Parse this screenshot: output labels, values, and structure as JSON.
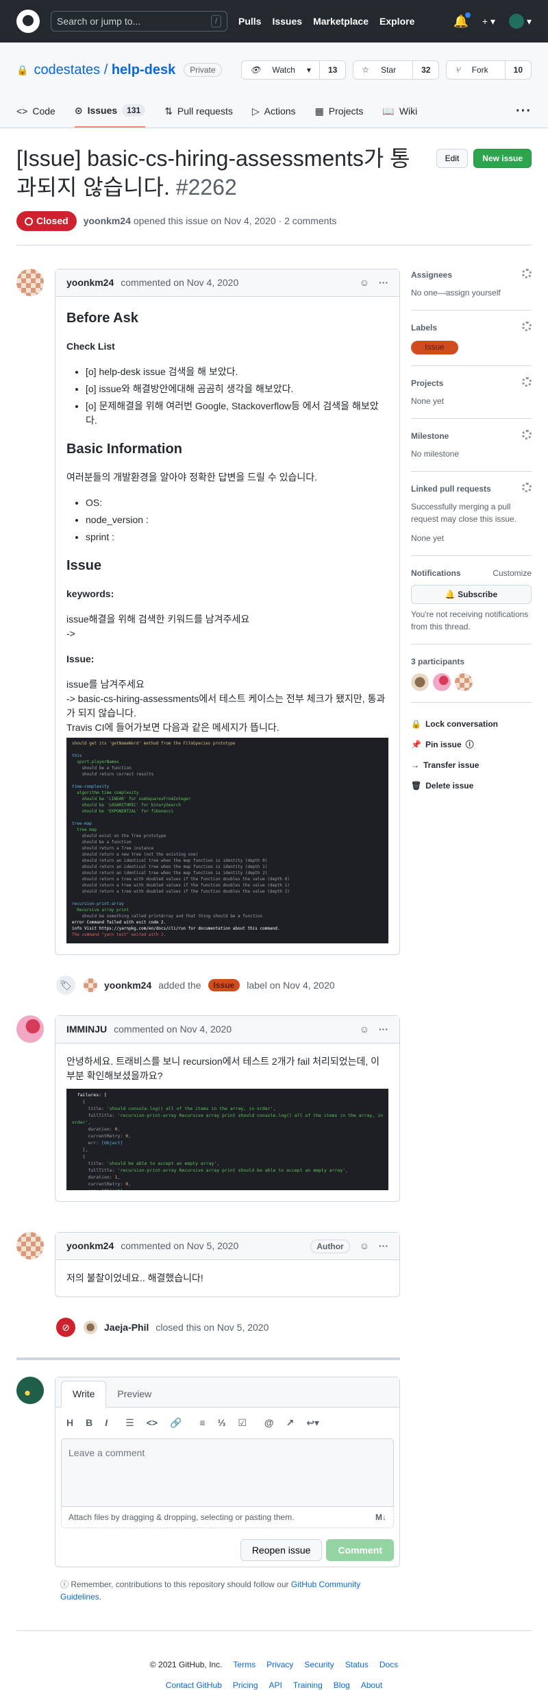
{
  "header": {
    "search_placeholder": "Search or jump to...",
    "slash": "/",
    "nav": [
      "Pulls",
      "Issues",
      "Marketplace",
      "Explore"
    ],
    "plus": "+ ▾",
    "avatar_caret": "▾"
  },
  "repo": {
    "owner": "codestates",
    "name": "help-desk",
    "visibility": "Private",
    "watch": "Watch",
    "watch_count": "13",
    "star": "Star",
    "star_count": "32",
    "fork": "Fork",
    "fork_count": "10"
  },
  "tabs": [
    {
      "label": "Code"
    },
    {
      "label": "Issues",
      "count": "131"
    },
    {
      "label": "Pull requests"
    },
    {
      "label": "Actions"
    },
    {
      "label": "Projects"
    },
    {
      "label": "Wiki"
    }
  ],
  "issue": {
    "title": "[Issue] basic-cs-hiring-assessments가 통과되지 않습니다.",
    "number": "#2262",
    "edit": "Edit",
    "new_issue": "New issue",
    "state": "Closed",
    "author": "yoonkm24",
    "meta": "opened this issue on Nov 4, 2020 · 2 comments"
  },
  "comment1": {
    "author": "yoonkm24",
    "date": "commented on Nov 4, 2020",
    "before_ask": "Before Ask",
    "check_list": "Check List",
    "checks": [
      "[o] help-desk issue 검색을 해 보았다.",
      "[o] issue와 해결방안에대해 곰곰히 생각을 해보았다.",
      "[o] 문제해결을 위해 여러번 Google, Stackoverflow등 에서 검색을 해보았다."
    ],
    "basic_info": "Basic Information",
    "info_text": "여러분들의 개발환경을 알아야 정확한 답변을 드릴 수 있습니다.",
    "info_items": [
      "OS:",
      "node_version :",
      "sprint :"
    ],
    "issue_h": "Issue",
    "keywords_h": "keywords:",
    "keywords_text": "issue해결을 위해 검색한 키워드를 남겨주세요",
    "arrow": "->",
    "issue_label": "Issue:",
    "issue_text1": "issue를 남겨주세요",
    "issue_text2": "-> basic-cs-hiring-assessments에서 테스트 케이스는 전부 체크가 됐지만, 통과가 되지 않습니다.",
    "issue_text3": "Travis CI에 들어가보면 다음과 같은 메세지가 뜹니다."
  },
  "labeled_event": {
    "author": "yoonkm24",
    "text1": "added the",
    "label": "Issue",
    "text2": "label on Nov 4, 2020"
  },
  "comment2": {
    "author": "IMMINJU",
    "date": "commented on Nov 4, 2020",
    "text": "안녕하세요. 트래비스를 보니 recursion에서 테스트 2개가 fail 처리되었는데, 이 부분 확인해보셨을까요?"
  },
  "comment3": {
    "author": "yoonkm24",
    "date": "commented on Nov 5, 2020",
    "badge": "Author",
    "text": "저의 불찰이었네요.. 해결했습니다!"
  },
  "closed_event": {
    "author": "Jaeja-Phil",
    "text": "closed this on Nov 5, 2020"
  },
  "composer": {
    "write": "Write",
    "preview": "Preview",
    "placeholder": "Leave a comment",
    "attach": "Attach files by dragging & dropping, selecting or pasting them.",
    "md": "M↓",
    "reopen": "Reopen issue",
    "comment": "Comment"
  },
  "remember": {
    "text": "Remember, contributions to this repository should follow our",
    "link": "GitHub Community Guidelines",
    "end": "."
  },
  "sidebar": {
    "assignees": "Assignees",
    "assignees_v": "No one—assign yourself",
    "labels": "Labels",
    "projects": "Projects",
    "projects_v": "None yet",
    "milestone": "Milestone",
    "milestone_v": "No milestone",
    "linked": "Linked pull requests",
    "linked_desc": "Successfully merging a pull request may close this issue.",
    "linked_v": "None yet",
    "notifications": "Notifications",
    "customize": "Customize",
    "subscribe": "Subscribe",
    "notif_desc": "You're not receiving notifications from this thread.",
    "participants": "3 participants",
    "lock": "Lock conversation",
    "pin": "Pin issue",
    "transfer": "Transfer issue",
    "delete": "Delete issue"
  },
  "footer": {
    "row1": [
      "© 2021 GitHub, Inc.",
      "Terms",
      "Privacy",
      "Security",
      "Status",
      "Docs"
    ],
    "row2": [
      "Contact GitHub",
      "Pricing",
      "API",
      "Training",
      "Blog",
      "About"
    ]
  }
}
